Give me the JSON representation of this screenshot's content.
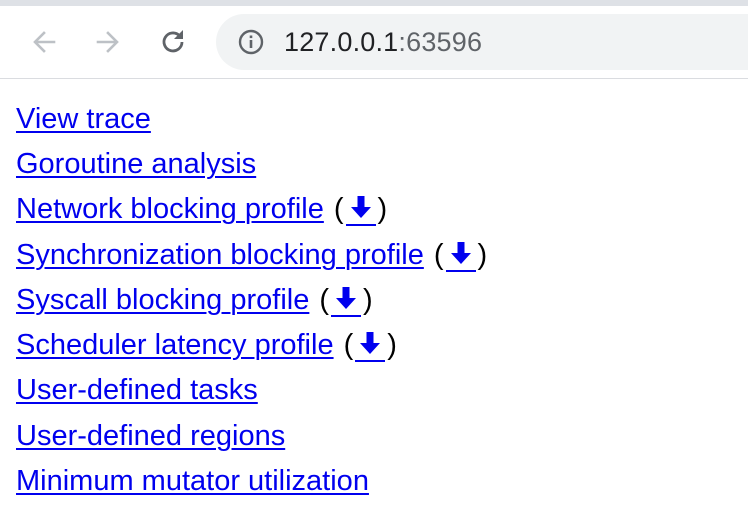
{
  "browser": {
    "url_host": "127.0.0.1",
    "url_port": ":63596",
    "back_icon": "arrow-left-icon",
    "forward_icon": "arrow-right-icon",
    "reload_icon": "reload-icon",
    "site_info_icon": "info-circle-icon"
  },
  "links": [
    {
      "label": "View trace",
      "download": false
    },
    {
      "label": "Goroutine analysis",
      "download": false
    },
    {
      "label": "Network blocking profile",
      "download": true
    },
    {
      "label": "Synchronization blocking profile",
      "download": true
    },
    {
      "label": "Syscall blocking profile",
      "download": true
    },
    {
      "label": "Scheduler latency profile",
      "download": true
    },
    {
      "label": "User-defined tasks",
      "download": false
    },
    {
      "label": "User-defined regions",
      "download": false
    },
    {
      "label": "Minimum mutator utilization",
      "download": false
    }
  ],
  "download_paren_open": "(",
  "download_paren_close": ")",
  "download_icon": "download-arrow-icon",
  "colors": {
    "link": "#0000ee",
    "omnibox_bg": "#f1f3f4",
    "nav_disabled": "#bdc1c6",
    "nav_enabled": "#5f6368"
  }
}
